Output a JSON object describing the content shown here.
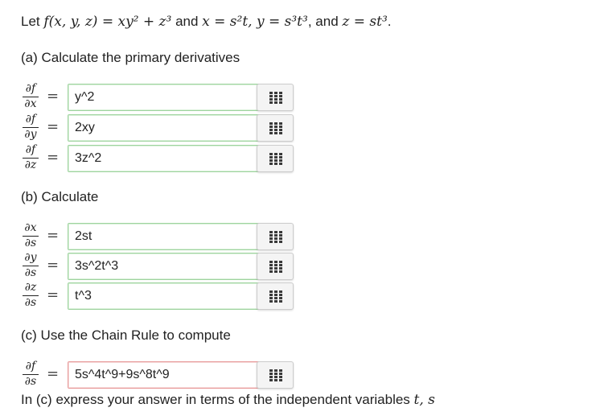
{
  "problem": {
    "let": "Let",
    "fdef": "f(x, y, z) = xy² + z³",
    "and1": "and",
    "xdef": "x = s²t, y = s³t³",
    "and2": ", and",
    "zdef": "z = st³",
    "period": "."
  },
  "part_a": {
    "heading": "(a) Calculate the primary derivatives",
    "rows": [
      {
        "num": "∂f",
        "den": "∂x",
        "eq": "=",
        "value": "y^2"
      },
      {
        "num": "∂f",
        "den": "∂y",
        "eq": "=",
        "value": "2xy"
      },
      {
        "num": "∂f",
        "den": "∂z",
        "eq": "=",
        "value": "3z^2"
      }
    ]
  },
  "part_b": {
    "heading": "(b) Calculate",
    "rows": [
      {
        "num": "∂x",
        "den": "∂s",
        "eq": "=",
        "value": "2st"
      },
      {
        "num": "∂y",
        "den": "∂s",
        "eq": "=",
        "value": "3s^2t^3"
      },
      {
        "num": "∂z",
        "den": "∂s",
        "eq": "=",
        "value": "t^3"
      }
    ]
  },
  "part_c": {
    "heading": "(c) Use the Chain Rule to compute",
    "rows": [
      {
        "num": "∂f",
        "den": "∂s",
        "eq": "=",
        "value": "5s^4t^9+9s^8t^9"
      }
    ]
  },
  "footer": {
    "text": "In (c) express your answer in terms of the independent variables",
    "vars": "t, s"
  },
  "icons": {
    "matrix_button": "grid-matrix-icon"
  },
  "colors": {
    "correct_border": "#9fd39f",
    "incorrect_border": "#e89a9a",
    "button_bg": "#f4f4f4"
  }
}
